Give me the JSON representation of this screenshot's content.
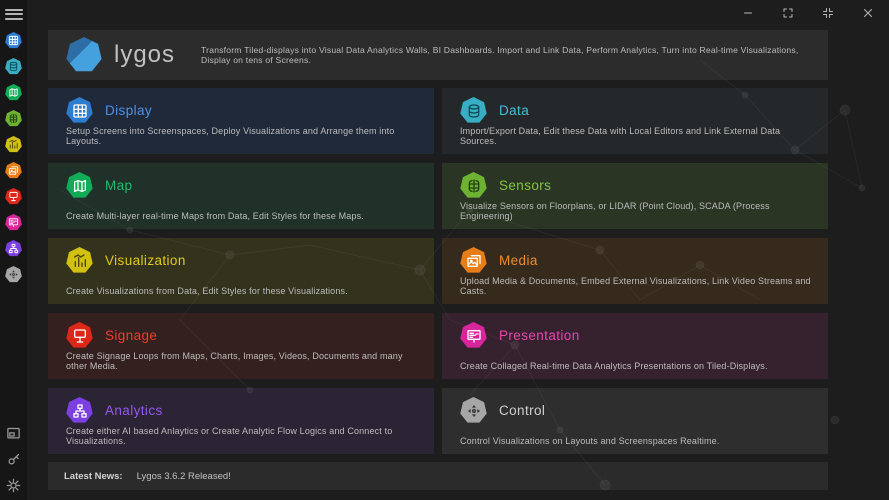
{
  "window": {
    "controls": [
      {
        "name": "minimize-button",
        "icon": "minimize-icon"
      },
      {
        "name": "fullscreen-button",
        "icon": "fullscreen-icon"
      },
      {
        "name": "compress-button",
        "icon": "compress-icon"
      },
      {
        "name": "close-button",
        "icon": "close-icon"
      }
    ]
  },
  "sidebar": {
    "menu_icon": "hamburger-icon",
    "bottom_tools": [
      {
        "name": "preview-window-button",
        "icon": "preview-window-icon"
      },
      {
        "name": "key-button",
        "icon": "key-icon"
      },
      {
        "name": "settings-button",
        "icon": "gear-icon"
      }
    ]
  },
  "header": {
    "brand": "lygos",
    "tagline": "Transform Tiled-displays into Visual Data Analytics Walls, BI Dashboards. Import and Link Data, Perform Analytics, Turn into Real-time Visualizations, Display on tens of Screens."
  },
  "modules": [
    {
      "id": "display",
      "label": "Display",
      "description": "Setup Screens into Screenspaces, Deploy Visualizations and Arrange them into Layouts.",
      "icon": "display-grid-icon",
      "accent": "#4a94e4",
      "icon_bg": "#2e7cd0",
      "glyph": "#ffffff",
      "card_bg": "#20293a"
    },
    {
      "id": "data",
      "label": "Data",
      "description": "Import/Export Data, Edit these Data with Local Editors and Link External Data Sources.",
      "icon": "database-icon",
      "accent": "#42c2d6",
      "icon_bg": "#37aec3",
      "glyph": "#104a55",
      "card_bg": "#25282b"
    },
    {
      "id": "map",
      "label": "Map",
      "description": "Create Multi-layer real-time Maps from Data, Edit Styles for these Maps.",
      "icon": "map-icon",
      "accent": "#23ba6b",
      "icon_bg": "#12ab58",
      "glyph": "#ffffff",
      "card_bg": "#203129"
    },
    {
      "id": "sensors",
      "label": "Sensors",
      "description": "Visualize Sensors on Floorplans, or LIDAR (Point Cloud), SCADA (Process Engineering)",
      "icon": "sensors-icon",
      "accent": "#83c541",
      "icon_bg": "#6db233",
      "glyph": "#1e3a0c",
      "card_bg": "#2a3524"
    },
    {
      "id": "visualization",
      "label": "Visualization",
      "description": "Create Visualizations from Data, Edit Styles for these Visualizations.",
      "icon": "bar-chart-icon",
      "accent": "#e0ca1d",
      "icon_bg": "#d2c012",
      "glyph": "#4a430a",
      "card_bg": "#33321d"
    },
    {
      "id": "media",
      "label": "Media",
      "description": "Upload Media & Documents, Embed External Visualizations, Link Video Streams and Casts.",
      "icon": "media-images-icon",
      "accent": "#f18d2a",
      "icon_bg": "#e77d18",
      "glyph": "#ffffff",
      "card_bg": "#362a1d"
    },
    {
      "id": "signage",
      "label": "Signage",
      "description": "Create Signage Loops from Maps, Charts, Images, Videos, Documents and many other Media.",
      "icon": "signpost-icon",
      "accent": "#ef3c2e",
      "icon_bg": "#dd2718",
      "glyph": "#ffffff",
      "card_bg": "#34201e"
    },
    {
      "id": "presentation",
      "label": "Presentation",
      "description": "Create Collaged Real-time Data Analytics Presentations on Tiled-Displays.",
      "icon": "presentation-board-icon",
      "accent": "#ec44b0",
      "icon_bg": "#d8259c",
      "glyph": "#ffffff",
      "card_bg": "#35222e"
    },
    {
      "id": "analytics",
      "label": "Analytics",
      "description": "Create either AI based Anlaytics or Create Analytic Flow Logics and Connect to Visualizations.",
      "icon": "flow-chart-icon",
      "accent": "#9459ee",
      "icon_bg": "#7c40e2",
      "glyph": "#ffffff",
      "card_bg": "#2b2434"
    },
    {
      "id": "control",
      "label": "Control",
      "description": "Control Visualizations on Layouts and Screenspaces Realtime.",
      "icon": "dpad-icon",
      "accent": "#cfcfcf",
      "icon_bg": "#a6a6a6",
      "glyph": "#333333",
      "card_bg": "#2e2e2e"
    }
  ],
  "news": {
    "label": "Latest News:",
    "text": "Lygos 3.6.2 Released!"
  }
}
